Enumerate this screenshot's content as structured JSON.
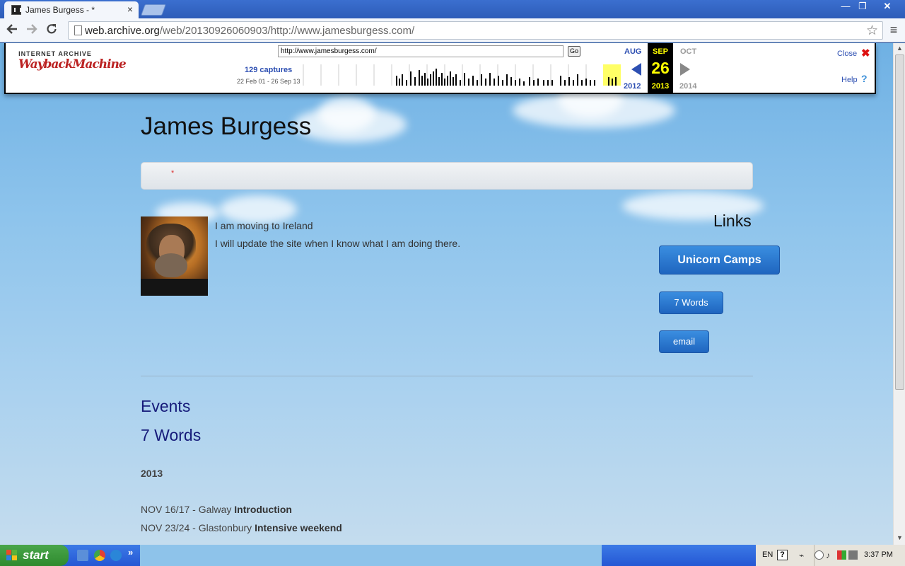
{
  "browser": {
    "tab_title": "James Burgess - *",
    "tab_close": "×",
    "url_host": "web.archive.org",
    "url_path": "/web/20130926060903/http://www.jamesburgess.com/",
    "window_controls": {
      "minimize": "—",
      "maximize": "❐",
      "close": "✕"
    },
    "icons": {
      "back": "back-arrow-icon",
      "forward": "forward-arrow-icon",
      "reload": "reload-icon",
      "bookmark": "star-icon",
      "menu": "hamburger-menu-icon"
    }
  },
  "wayback": {
    "logo_line1": "INTERNET ARCHIVE",
    "logo_line2": "WaybackMachine",
    "url_value": "http://www.jamesburgess.com/",
    "go_label": "Go",
    "captures": "129 captures",
    "range": "22 Feb 01 - 26 Sep 13",
    "prev_month": "AUG",
    "current_month": "SEP",
    "next_month": "OCT",
    "current_day": "26",
    "prev_year": "2012",
    "current_year": "2013",
    "next_year": "2014",
    "close_label": "Close",
    "help_label": "Help"
  },
  "site": {
    "title": "James Burgess",
    "nav_marker": "*",
    "intro": [
      "I am moving to Ireland",
      "I will update the site when I know what I am doing there."
    ],
    "links_heading": "Links",
    "links": {
      "unicorn": "Unicorn Camps",
      "words": "7 Words",
      "email": "email"
    },
    "events_heading": "Events",
    "words_heading": "7 Words",
    "year": "2013",
    "events": [
      {
        "date_place": "NOV 16/17 - Galway ",
        "name": "Introduction"
      },
      {
        "date_place": "NOV 23/24 - Glastonbury ",
        "name": "Intensive weekend"
      }
    ]
  },
  "taskbar": {
    "start_label": "start",
    "language": "EN",
    "help_glyph": "?",
    "clock": "3:37 PM"
  },
  "colors": {
    "link_heading": "#161b7a",
    "button_blue": "#1f65bf",
    "wayback_blue": "#2d4fb2",
    "wayback_highlight": "#ffff00"
  }
}
